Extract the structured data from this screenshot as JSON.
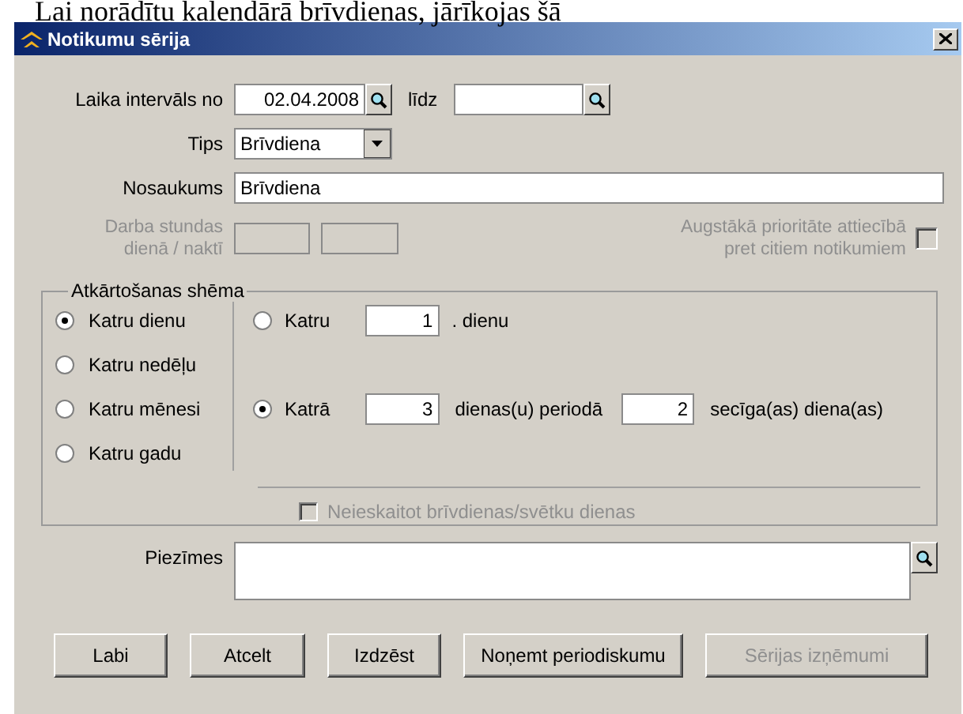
{
  "caption": "Lai norādītu kalendārā brīvdienas, jārīkojas šā",
  "window": {
    "title": "Notikumu sērija"
  },
  "interval": {
    "label": "Laika intervāls no",
    "from": "02.04.2008",
    "to_label": "līdz"
  },
  "type": {
    "label": "Tips",
    "value": "Brīvdiena"
  },
  "name": {
    "label": "Nosaukums",
    "value": "Brīvdiena"
  },
  "work_hours": {
    "label_lines": [
      "Darba stundas",
      "dienā / naktī"
    ],
    "disabled": true
  },
  "priority": {
    "label_lines": [
      "Augstākā prioritāte attiecībā",
      "pret citiem notikumiem"
    ],
    "checked": false,
    "disabled": true
  },
  "schedule": {
    "legend": "Atkārtošanas shēma",
    "frequencies": [
      {
        "label": "Katru dienu",
        "selected": true
      },
      {
        "label": "Katru nedēļu",
        "selected": false
      },
      {
        "label": "Katru mēnesi",
        "selected": false
      },
      {
        "label": "Katru gadu",
        "selected": false
      }
    ],
    "modes": [
      {
        "kind": "every",
        "selected": false,
        "prefix": "Katru",
        "count": "1",
        "suffix": ". dienu"
      },
      {
        "kind": "cycle",
        "selected": true,
        "prefix": "Katrā",
        "count": "3",
        "middle": "dienas(u) periodā",
        "count2": "2",
        "suffix": "secīga(as) diena(as)"
      }
    ],
    "exclude_holidays": {
      "label": "Neieskaitot brīvdienas/svētku dienas",
      "checked": false,
      "disabled": true
    }
  },
  "notes": {
    "label": "Piezīmes"
  },
  "buttons": [
    {
      "label": "Labi",
      "disabled": false
    },
    {
      "label": "Atcelt",
      "disabled": false
    },
    {
      "label": "Izdzēst",
      "disabled": false
    },
    {
      "label": "Noņemt periodiskumu",
      "disabled": false
    },
    {
      "label": "Sērijas izņēmumi",
      "disabled": true
    }
  ]
}
